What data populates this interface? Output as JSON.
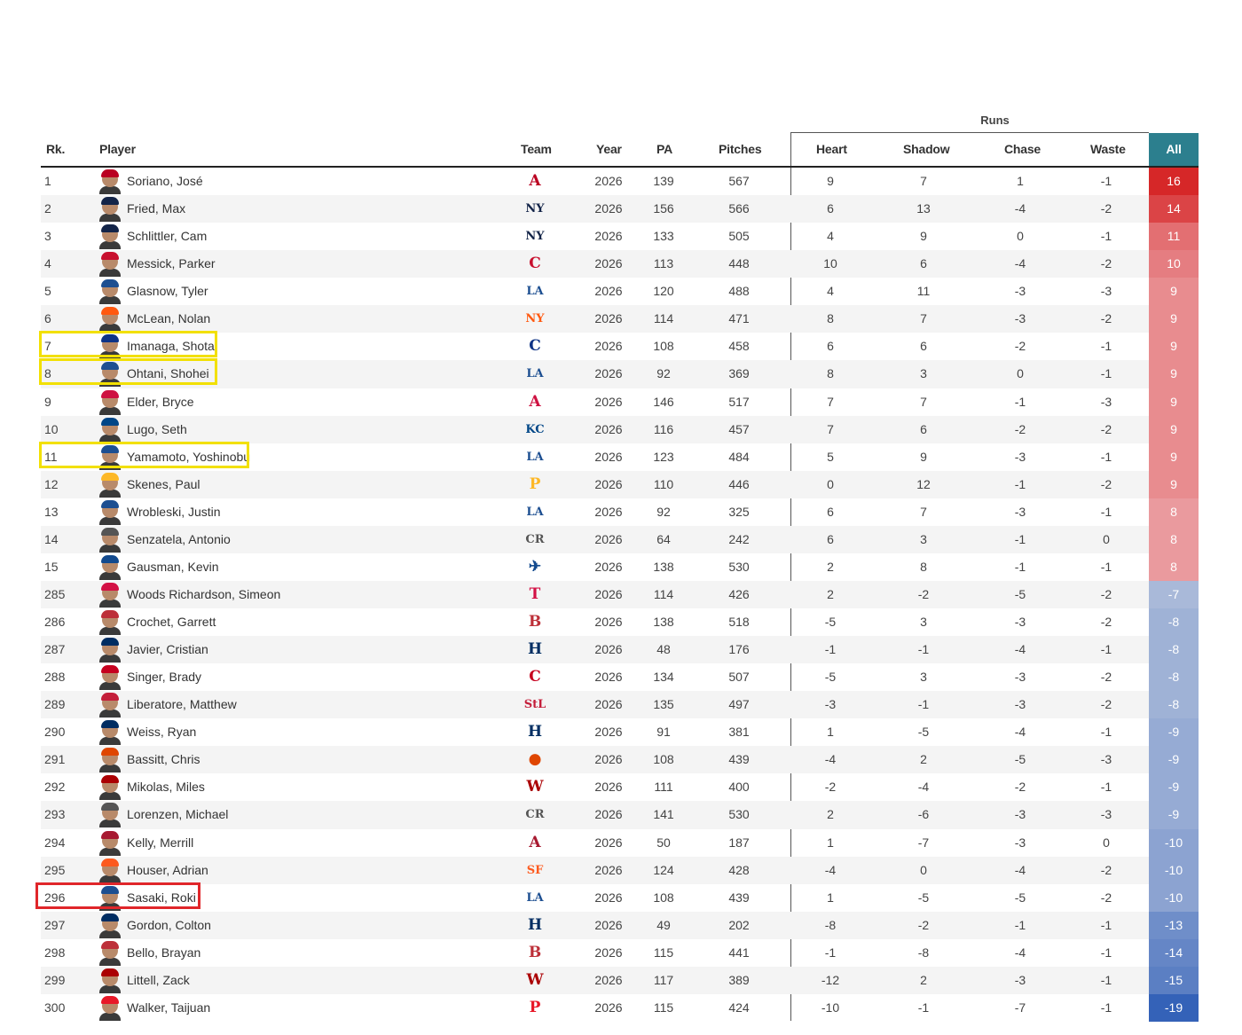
{
  "header": {
    "group_label": "Runs",
    "rank": "Rk.",
    "player": "Player",
    "team": "Team",
    "year": "Year",
    "pa": "PA",
    "pitches": "Pitches",
    "heart": "Heart",
    "shadow": "Shadow",
    "chase": "Chase",
    "waste": "Waste",
    "all": "All"
  },
  "colors": {
    "header_all_bg": "#2c7f8e",
    "highlight_yellow": "#f2e000",
    "highlight_red": "#e0262a",
    "positive_scale": [
      "#ea9a9e",
      "#d62728"
    ],
    "negative_scale": [
      "#a9b9d9",
      "#3462b8"
    ]
  },
  "highlights": [
    {
      "rank": "7",
      "color": "yellow"
    },
    {
      "rank": "8",
      "color": "yellow"
    },
    {
      "rank": "11",
      "color": "yellow"
    },
    {
      "rank": "296",
      "color": "red"
    }
  ],
  "rows": [
    {
      "rank": "1",
      "player": "Soriano, José",
      "team_icon": "angels-logo",
      "team_glyph": "A",
      "team_color": "#ba0021",
      "year": "2026",
      "pa": "139",
      "pitches": "567",
      "heart": "9",
      "shadow": "7",
      "chase": "1",
      "waste": "-1",
      "all": "16"
    },
    {
      "rank": "2",
      "player": "Fried, Max",
      "team_icon": "yankees-logo",
      "team_glyph": "NY",
      "team_color": "#132448",
      "year": "2026",
      "pa": "156",
      "pitches": "566",
      "heart": "6",
      "shadow": "13",
      "chase": "-4",
      "waste": "-2",
      "all": "14"
    },
    {
      "rank": "3",
      "player": "Schlittler, Cam",
      "team_icon": "yankees-logo",
      "team_glyph": "NY",
      "team_color": "#132448",
      "year": "2026",
      "pa": "133",
      "pitches": "505",
      "heart": "4",
      "shadow": "9",
      "chase": "0",
      "waste": "-1",
      "all": "11"
    },
    {
      "rank": "4",
      "player": "Messick, Parker",
      "team_icon": "guardians-logo",
      "team_glyph": "C",
      "team_color": "#c8102e",
      "year": "2026",
      "pa": "113",
      "pitches": "448",
      "heart": "10",
      "shadow": "6",
      "chase": "-4",
      "waste": "-2",
      "all": "10"
    },
    {
      "rank": "5",
      "player": "Glasnow, Tyler",
      "team_icon": "dodgers-logo",
      "team_glyph": "LA",
      "team_color": "#1d4f91",
      "year": "2026",
      "pa": "120",
      "pitches": "488",
      "heart": "4",
      "shadow": "11",
      "chase": "-3",
      "waste": "-3",
      "all": "9"
    },
    {
      "rank": "6",
      "player": "McLean, Nolan",
      "team_icon": "mets-logo",
      "team_glyph": "NY",
      "team_color": "#ff5910",
      "year": "2026",
      "pa": "114",
      "pitches": "471",
      "heart": "8",
      "shadow": "7",
      "chase": "-3",
      "waste": "-2",
      "all": "9"
    },
    {
      "rank": "7",
      "player": "Imanaga, Shota",
      "team_icon": "cubs-logo",
      "team_glyph": "C",
      "team_color": "#0e3386",
      "year": "2026",
      "pa": "108",
      "pitches": "458",
      "heart": "6",
      "shadow": "6",
      "chase": "-2",
      "waste": "-1",
      "all": "9"
    },
    {
      "rank": "8",
      "player": "Ohtani, Shohei",
      "team_icon": "dodgers-logo",
      "team_glyph": "LA",
      "team_color": "#1d4f91",
      "year": "2026",
      "pa": "92",
      "pitches": "369",
      "heart": "8",
      "shadow": "3",
      "chase": "0",
      "waste": "-1",
      "all": "9"
    },
    {
      "rank": "9",
      "player": "Elder, Bryce",
      "team_icon": "braves-logo",
      "team_glyph": "A",
      "team_color": "#ce1141",
      "year": "2026",
      "pa": "146",
      "pitches": "517",
      "heart": "7",
      "shadow": "7",
      "chase": "-1",
      "waste": "-3",
      "all": "9"
    },
    {
      "rank": "10",
      "player": "Lugo, Seth",
      "team_icon": "royals-logo",
      "team_glyph": "KC",
      "team_color": "#004687",
      "year": "2026",
      "pa": "116",
      "pitches": "457",
      "heart": "7",
      "shadow": "6",
      "chase": "-2",
      "waste": "-2",
      "all": "9"
    },
    {
      "rank": "11",
      "player": "Yamamoto, Yoshinobu",
      "team_icon": "dodgers-logo",
      "team_glyph": "LA",
      "team_color": "#1d4f91",
      "year": "2026",
      "pa": "123",
      "pitches": "484",
      "heart": "5",
      "shadow": "9",
      "chase": "-3",
      "waste": "-1",
      "all": "9"
    },
    {
      "rank": "12",
      "player": "Skenes, Paul",
      "team_icon": "pirates-logo",
      "team_glyph": "P",
      "team_color": "#fdb827",
      "year": "2026",
      "pa": "110",
      "pitches": "446",
      "heart": "0",
      "shadow": "12",
      "chase": "-1",
      "waste": "-2",
      "all": "9"
    },
    {
      "rank": "13",
      "player": "Wrobleski, Justin",
      "team_icon": "dodgers-logo",
      "team_glyph": "LA",
      "team_color": "#1d4f91",
      "year": "2026",
      "pa": "92",
      "pitches": "325",
      "heart": "6",
      "shadow": "7",
      "chase": "-3",
      "waste": "-1",
      "all": "8"
    },
    {
      "rank": "14",
      "player": "Senzatela, Antonio",
      "team_icon": "rockies-logo",
      "team_glyph": "CR",
      "team_color": "#555555",
      "year": "2026",
      "pa": "64",
      "pitches": "242",
      "heart": "6",
      "shadow": "3",
      "chase": "-1",
      "waste": "0",
      "all": "8"
    },
    {
      "rank": "15",
      "player": "Gausman, Kevin",
      "team_icon": "bluejays-logo",
      "team_glyph": "✈",
      "team_color": "#134a8e",
      "year": "2026",
      "pa": "138",
      "pitches": "530",
      "heart": "2",
      "shadow": "8",
      "chase": "-1",
      "waste": "-1",
      "all": "8"
    },
    {
      "rank": "285",
      "player": "Woods Richardson, Simeon",
      "team_icon": "twins-logo",
      "team_glyph": "T",
      "team_color": "#d31145",
      "year": "2026",
      "pa": "114",
      "pitches": "426",
      "heart": "2",
      "shadow": "-2",
      "chase": "-5",
      "waste": "-2",
      "all": "-7"
    },
    {
      "rank": "286",
      "player": "Crochet, Garrett",
      "team_icon": "redsox-logo",
      "team_glyph": "B",
      "team_color": "#bd3039",
      "year": "2026",
      "pa": "138",
      "pitches": "518",
      "heart": "-5",
      "shadow": "3",
      "chase": "-3",
      "waste": "-2",
      "all": "-8"
    },
    {
      "rank": "287",
      "player": "Javier, Cristian",
      "team_icon": "astros-logo",
      "team_glyph": "H",
      "team_color": "#002d62",
      "year": "2026",
      "pa": "48",
      "pitches": "176",
      "heart": "-1",
      "shadow": "-1",
      "chase": "-4",
      "waste": "-1",
      "all": "-8"
    },
    {
      "rank": "288",
      "player": "Singer, Brady",
      "team_icon": "reds-logo",
      "team_glyph": "C",
      "team_color": "#c6011f",
      "year": "2026",
      "pa": "134",
      "pitches": "507",
      "heart": "-5",
      "shadow": "3",
      "chase": "-3",
      "waste": "-2",
      "all": "-8"
    },
    {
      "rank": "289",
      "player": "Liberatore, Matthew",
      "team_icon": "cardinals-logo",
      "team_glyph": "StL",
      "team_color": "#c41e3a",
      "year": "2026",
      "pa": "135",
      "pitches": "497",
      "heart": "-3",
      "shadow": "-1",
      "chase": "-3",
      "waste": "-2",
      "all": "-8"
    },
    {
      "rank": "290",
      "player": "Weiss, Ryan",
      "team_icon": "astros-logo",
      "team_glyph": "H",
      "team_color": "#002d62",
      "year": "2026",
      "pa": "91",
      "pitches": "381",
      "heart": "1",
      "shadow": "-5",
      "chase": "-4",
      "waste": "-1",
      "all": "-9"
    },
    {
      "rank": "291",
      "player": "Bassitt, Chris",
      "team_icon": "orioles-logo",
      "team_glyph": "●",
      "team_color": "#df4601",
      "year": "2026",
      "pa": "108",
      "pitches": "439",
      "heart": "-4",
      "shadow": "2",
      "chase": "-5",
      "waste": "-3",
      "all": "-9"
    },
    {
      "rank": "292",
      "player": "Mikolas, Miles",
      "team_icon": "nationals-logo",
      "team_glyph": "W",
      "team_color": "#ab0003",
      "year": "2026",
      "pa": "111",
      "pitches": "400",
      "heart": "-2",
      "shadow": "-4",
      "chase": "-2",
      "waste": "-1",
      "all": "-9"
    },
    {
      "rank": "293",
      "player": "Lorenzen, Michael",
      "team_icon": "rockies-logo",
      "team_glyph": "CR",
      "team_color": "#555555",
      "year": "2026",
      "pa": "141",
      "pitches": "530",
      "heart": "2",
      "shadow": "-6",
      "chase": "-3",
      "waste": "-3",
      "all": "-9"
    },
    {
      "rank": "294",
      "player": "Kelly, Merrill",
      "team_icon": "diamondbacks-logo",
      "team_glyph": "A",
      "team_color": "#a71930",
      "year": "2026",
      "pa": "50",
      "pitches": "187",
      "heart": "1",
      "shadow": "-7",
      "chase": "-3",
      "waste": "0",
      "all": "-10"
    },
    {
      "rank": "295",
      "player": "Houser, Adrian",
      "team_icon": "giants-logo",
      "team_glyph": "SF",
      "team_color": "#fd5a1e",
      "year": "2026",
      "pa": "124",
      "pitches": "428",
      "heart": "-4",
      "shadow": "0",
      "chase": "-4",
      "waste": "-2",
      "all": "-10"
    },
    {
      "rank": "296",
      "player": "Sasaki, Roki",
      "team_icon": "dodgers-logo",
      "team_glyph": "LA",
      "team_color": "#1d4f91",
      "year": "2026",
      "pa": "108",
      "pitches": "439",
      "heart": "1",
      "shadow": "-5",
      "chase": "-5",
      "waste": "-2",
      "all": "-10"
    },
    {
      "rank": "297",
      "player": "Gordon, Colton",
      "team_icon": "astros-logo",
      "team_glyph": "H",
      "team_color": "#002d62",
      "year": "2026",
      "pa": "49",
      "pitches": "202",
      "heart": "-8",
      "shadow": "-2",
      "chase": "-1",
      "waste": "-1",
      "all": "-13"
    },
    {
      "rank": "298",
      "player": "Bello, Brayan",
      "team_icon": "redsox-logo",
      "team_glyph": "B",
      "team_color": "#bd3039",
      "year": "2026",
      "pa": "115",
      "pitches": "441",
      "heart": "-1",
      "shadow": "-8",
      "chase": "-4",
      "waste": "-1",
      "all": "-14"
    },
    {
      "rank": "299",
      "player": "Littell, Zack",
      "team_icon": "nationals-logo",
      "team_glyph": "W",
      "team_color": "#ab0003",
      "year": "2026",
      "pa": "117",
      "pitches": "389",
      "heart": "-12",
      "shadow": "2",
      "chase": "-3",
      "waste": "-1",
      "all": "-15"
    },
    {
      "rank": "300",
      "player": "Walker, Taijuan",
      "team_icon": "phillies-logo",
      "team_glyph": "P",
      "team_color": "#e81828",
      "year": "2026",
      "pa": "115",
      "pitches": "424",
      "heart": "-10",
      "shadow": "-1",
      "chase": "-7",
      "waste": "-1",
      "all": "-19"
    }
  ]
}
